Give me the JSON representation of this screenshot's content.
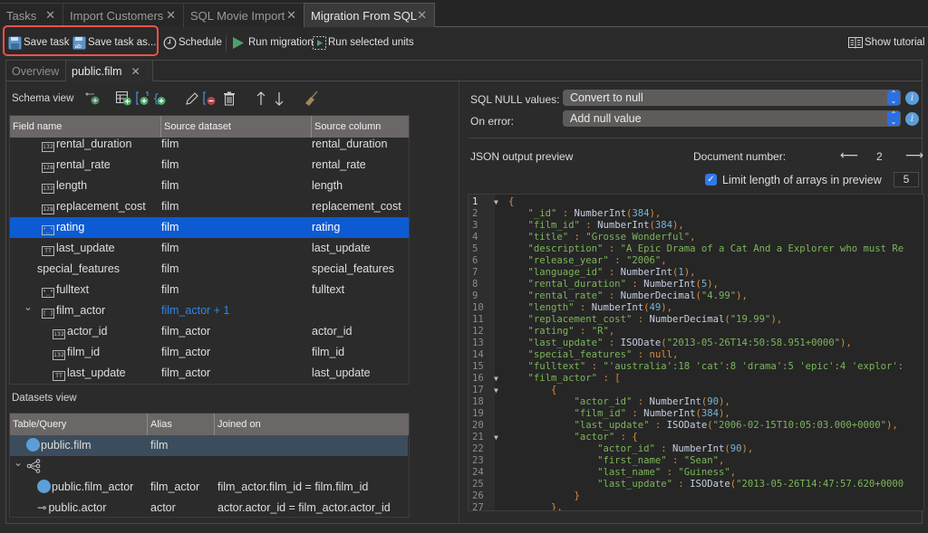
{
  "tabs": [
    {
      "label": "Tasks",
      "active": false
    },
    {
      "label": "Import Customers",
      "active": false
    },
    {
      "label": "SQL Movie Import",
      "active": false
    },
    {
      "label": "Migration From SQL",
      "active": true
    }
  ],
  "toolbar": {
    "save_task": "Save task",
    "save_task_as": "Save task as...",
    "schedule": "Schedule",
    "run_migration": "Run migration",
    "run_selected_units": "Run selected units",
    "show_tutorial": "Show tutorial"
  },
  "subtabs": [
    {
      "label": "Overview",
      "active": false
    },
    {
      "label": "public.film",
      "active": true
    }
  ],
  "schema_view": {
    "title": "Schema view",
    "columns": [
      "Field name",
      "Source dataset",
      "Source column"
    ],
    "rows": [
      {
        "icon": "i32",
        "field": "rental_duration",
        "dataset": "film",
        "column": "rental_duration",
        "indent": 1
      },
      {
        "icon": "128",
        "field": "rental_rate",
        "dataset": "film",
        "column": "rental_rate",
        "indent": 1
      },
      {
        "icon": "i32",
        "field": "length",
        "dataset": "film",
        "column": "length",
        "indent": 1
      },
      {
        "icon": "128",
        "field": "replacement_cost",
        "dataset": "film",
        "column": "replacement_cost",
        "indent": 1
      },
      {
        "icon": "str",
        "field": "rating",
        "dataset": "film",
        "column": "rating",
        "indent": 1,
        "selected": true
      },
      {
        "icon": "date",
        "field": "last_update",
        "dataset": "film",
        "column": "last_update",
        "indent": 1
      },
      {
        "icon": "",
        "field": "special_features",
        "dataset": "film",
        "column": "special_features",
        "indent": 1
      },
      {
        "icon": "str",
        "field": "fulltext",
        "dataset": "film",
        "column": "fulltext",
        "indent": 1
      },
      {
        "icon": "arr",
        "field": "film_actor",
        "dataset": "film_actor + 1",
        "column": "",
        "indent": 1,
        "expanded": true,
        "link": true
      },
      {
        "icon": "i32",
        "field": "actor_id",
        "dataset": "film_actor",
        "column": "actor_id",
        "indent": 2
      },
      {
        "icon": "i32",
        "field": "film_id",
        "dataset": "film_actor",
        "column": "film_id",
        "indent": 2
      },
      {
        "icon": "date",
        "field": "last_update",
        "dataset": "film_actor",
        "column": "last_update",
        "indent": 2
      }
    ]
  },
  "datasets_view": {
    "title": "Datasets view",
    "columns": [
      "Table/Query",
      "Alias",
      "Joined on"
    ],
    "rows": [
      {
        "icon": "table",
        "name": "public.film",
        "alias": "film",
        "joined_on": "",
        "selected": true
      },
      {
        "icon": "join",
        "name": "",
        "alias": "",
        "joined_on": "",
        "expanded": true
      },
      {
        "icon": "table",
        "name": "public.film_actor",
        "alias": "film_actor",
        "joined_on": "film_actor.film_id = film.film_id"
      },
      {
        "icon": "link",
        "name": "public.actor",
        "alias": "actor",
        "joined_on": "actor.actor_id = film_actor.actor_id"
      }
    ]
  },
  "options": {
    "sql_null_label": "SQL NULL values:",
    "sql_null_value": "Convert to null",
    "on_error_label": "On error:",
    "on_error_value": "Add null value"
  },
  "preview": {
    "title": "JSON output preview",
    "document_number_label": "Document number:",
    "document_number": "2",
    "limit_arrays_label": "Limit length of arrays in preview",
    "limit_arrays_checked": true,
    "limit_arrays_value": "5"
  },
  "colors": {
    "accent": "#0c5bd3",
    "highlight_box": "#e9524a",
    "code_key": "#7cb55a",
    "code_punct": "#d98c3a",
    "code_number": "#78b4d6"
  },
  "code_lines": [
    {
      "n": "1",
      "fold": true,
      "indent": 0,
      "parts": [
        [
          "p",
          "{"
        ]
      ]
    },
    {
      "n": "2",
      "indent": 1,
      "parts": [
        [
          "k",
          "\"_id\""
        ],
        [
          "p",
          " : "
        ],
        [
          "fn",
          "NumberInt"
        ],
        [
          "p",
          "("
        ],
        [
          "n",
          "384"
        ],
        [
          "p",
          "),"
        ]
      ]
    },
    {
      "n": "3",
      "indent": 1,
      "parts": [
        [
          "k",
          "\"film_id\""
        ],
        [
          "p",
          " : "
        ],
        [
          "fn",
          "NumberInt"
        ],
        [
          "p",
          "("
        ],
        [
          "n",
          "384"
        ],
        [
          "p",
          "),"
        ]
      ]
    },
    {
      "n": "4",
      "indent": 1,
      "parts": [
        [
          "k",
          "\"title\""
        ],
        [
          "p",
          " : "
        ],
        [
          "s",
          "\"Grosse Wonderful\""
        ],
        [
          "p",
          ","
        ]
      ]
    },
    {
      "n": "5",
      "indent": 1,
      "parts": [
        [
          "k",
          "\"description\""
        ],
        [
          "p",
          " : "
        ],
        [
          "s",
          "\"A Epic Drama of a Cat And a Explorer who must Re"
        ]
      ]
    },
    {
      "n": "6",
      "indent": 1,
      "parts": [
        [
          "k",
          "\"release_year\""
        ],
        [
          "p",
          " : "
        ],
        [
          "s",
          "\"2006\""
        ],
        [
          "p",
          ","
        ]
      ]
    },
    {
      "n": "7",
      "indent": 1,
      "parts": [
        [
          "k",
          "\"language_id\""
        ],
        [
          "p",
          " : "
        ],
        [
          "fn",
          "NumberInt"
        ],
        [
          "p",
          "("
        ],
        [
          "n",
          "1"
        ],
        [
          "p",
          "),"
        ]
      ]
    },
    {
      "n": "8",
      "indent": 1,
      "parts": [
        [
          "k",
          "\"rental_duration\""
        ],
        [
          "p",
          " : "
        ],
        [
          "fn",
          "NumberInt"
        ],
        [
          "p",
          "("
        ],
        [
          "n",
          "5"
        ],
        [
          "p",
          "),"
        ]
      ]
    },
    {
      "n": "9",
      "indent": 1,
      "parts": [
        [
          "k",
          "\"rental_rate\""
        ],
        [
          "p",
          " : "
        ],
        [
          "fn",
          "NumberDecimal"
        ],
        [
          "p",
          "("
        ],
        [
          "s",
          "\"4.99\""
        ],
        [
          "p",
          "),"
        ]
      ]
    },
    {
      "n": "10",
      "indent": 1,
      "parts": [
        [
          "k",
          "\"length\""
        ],
        [
          "p",
          " : "
        ],
        [
          "fn",
          "NumberInt"
        ],
        [
          "p",
          "("
        ],
        [
          "n",
          "49"
        ],
        [
          "p",
          "),"
        ]
      ]
    },
    {
      "n": "11",
      "indent": 1,
      "parts": [
        [
          "k",
          "\"replacement_cost\""
        ],
        [
          "p",
          " : "
        ],
        [
          "fn",
          "NumberDecimal"
        ],
        [
          "p",
          "("
        ],
        [
          "s",
          "\"19.99\""
        ],
        [
          "p",
          "),"
        ]
      ]
    },
    {
      "n": "12",
      "indent": 1,
      "parts": [
        [
          "k",
          "\"rating\""
        ],
        [
          "p",
          " : "
        ],
        [
          "s",
          "\"R\""
        ],
        [
          "p",
          ","
        ]
      ]
    },
    {
      "n": "13",
      "indent": 1,
      "parts": [
        [
          "k",
          "\"last_update\""
        ],
        [
          "p",
          " : "
        ],
        [
          "fn",
          "ISODate"
        ],
        [
          "p",
          "("
        ],
        [
          "s",
          "\"2013-05-26T14:50:58.951+0000\""
        ],
        [
          "p",
          "),"
        ]
      ]
    },
    {
      "n": "14",
      "indent": 1,
      "parts": [
        [
          "k",
          "\"special_features\""
        ],
        [
          "p",
          " : "
        ],
        [
          "nl",
          "null"
        ],
        [
          "p",
          ","
        ]
      ]
    },
    {
      "n": "15",
      "indent": 1,
      "parts": [
        [
          "k",
          "\"fulltext\""
        ],
        [
          "p",
          " : "
        ],
        [
          "s",
          "\"'australia':18 'cat':8 'drama':5 'epic':4 'explor':"
        ]
      ]
    },
    {
      "n": "16",
      "fold": true,
      "indent": 1,
      "parts": [
        [
          "k",
          "\"film_actor\""
        ],
        [
          "p",
          " : ["
        ]
      ]
    },
    {
      "n": "17",
      "fold": true,
      "indent": 2,
      "parts": [
        [
          "p",
          "{"
        ]
      ]
    },
    {
      "n": "18",
      "indent": 3,
      "parts": [
        [
          "k",
          "\"actor_id\""
        ],
        [
          "p",
          " : "
        ],
        [
          "fn",
          "NumberInt"
        ],
        [
          "p",
          "("
        ],
        [
          "n",
          "90"
        ],
        [
          "p",
          "),"
        ]
      ]
    },
    {
      "n": "19",
      "indent": 3,
      "parts": [
        [
          "k",
          "\"film_id\""
        ],
        [
          "p",
          " : "
        ],
        [
          "fn",
          "NumberInt"
        ],
        [
          "p",
          "("
        ],
        [
          "n",
          "384"
        ],
        [
          "p",
          "),"
        ]
      ]
    },
    {
      "n": "20",
      "indent": 3,
      "parts": [
        [
          "k",
          "\"last_update\""
        ],
        [
          "p",
          " : "
        ],
        [
          "fn",
          "ISODate"
        ],
        [
          "p",
          "("
        ],
        [
          "s",
          "\"2006-02-15T10:05:03.000+0000\""
        ],
        [
          "p",
          "),"
        ]
      ]
    },
    {
      "n": "21",
      "fold": true,
      "indent": 3,
      "parts": [
        [
          "k",
          "\"actor\""
        ],
        [
          "p",
          " : {"
        ]
      ]
    },
    {
      "n": "22",
      "indent": 4,
      "parts": [
        [
          "k",
          "\"actor_id\""
        ],
        [
          "p",
          " : "
        ],
        [
          "fn",
          "NumberInt"
        ],
        [
          "p",
          "("
        ],
        [
          "n",
          "90"
        ],
        [
          "p",
          "),"
        ]
      ]
    },
    {
      "n": "23",
      "indent": 4,
      "parts": [
        [
          "k",
          "\"first_name\""
        ],
        [
          "p",
          " : "
        ],
        [
          "s",
          "\"Sean\""
        ],
        [
          "p",
          ","
        ]
      ]
    },
    {
      "n": "24",
      "indent": 4,
      "parts": [
        [
          "k",
          "\"last_name\""
        ],
        [
          "p",
          " : "
        ],
        [
          "s",
          "\"Guiness\""
        ],
        [
          "p",
          ","
        ]
      ]
    },
    {
      "n": "25",
      "indent": 4,
      "parts": [
        [
          "k",
          "\"last_update\""
        ],
        [
          "p",
          " : "
        ],
        [
          "fn",
          "ISODate"
        ],
        [
          "p",
          "("
        ],
        [
          "s",
          "\"2013-05-26T14:47:57.620+0000"
        ]
      ]
    },
    {
      "n": "26",
      "indent": 3,
      "parts": [
        [
          "p",
          "}"
        ]
      ]
    },
    {
      "n": "27",
      "indent": 2,
      "parts": [
        [
          "p",
          "},"
        ]
      ]
    }
  ]
}
